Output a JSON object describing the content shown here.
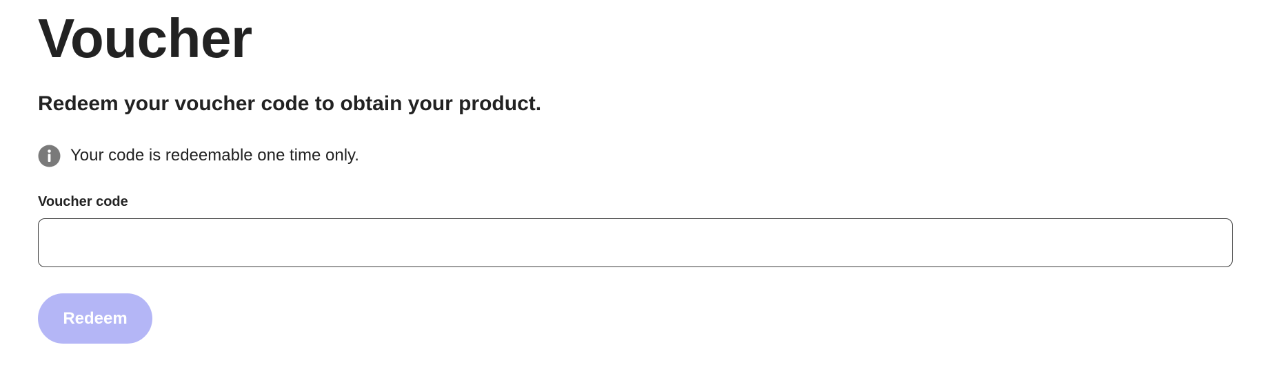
{
  "page": {
    "title": "Voucher",
    "subtitle": "Redeem your voucher code to obtain your product."
  },
  "notice": {
    "icon": "info-icon",
    "text": "Your code is redeemable one time only."
  },
  "form": {
    "voucher_label": "Voucher code",
    "voucher_value": "",
    "redeem_label": "Redeem",
    "redeem_disabled": true
  },
  "colors": {
    "text": "#222222",
    "icon": "#7a7a7a",
    "input_border": "#3a3a3a",
    "button_disabled_bg": "#b4b6f6",
    "button_text": "#ffffff"
  }
}
